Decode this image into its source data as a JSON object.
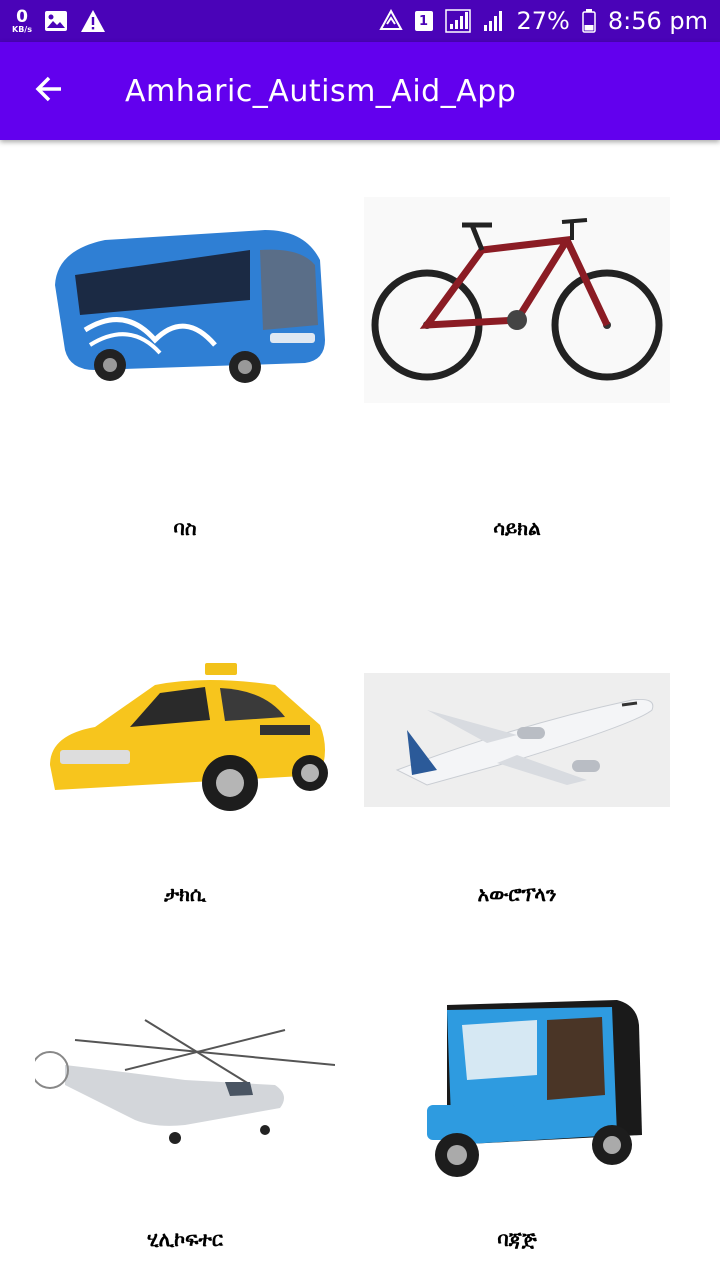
{
  "status_bar": {
    "net_speed_value": "0",
    "net_speed_unit": "KB/s",
    "sim_slot": "1",
    "battery_percent": "27%",
    "time": "8:56 pm"
  },
  "app_bar": {
    "title": "Amharic_Autism_Aid_App"
  },
  "items": [
    {
      "label": "ባስ"
    },
    {
      "label": "ሳይክል"
    },
    {
      "label": "ታክሲ"
    },
    {
      "label": "አውሮፕላን"
    },
    {
      "label": "ሂሊኮፍተር"
    },
    {
      "label": "ባጃጅ"
    }
  ],
  "colors": {
    "status_bar": "#4a03b8",
    "app_bar": "#6200ee",
    "background": "#ffffff"
  },
  "icons": {
    "back": "arrow-left-icon"
  }
}
